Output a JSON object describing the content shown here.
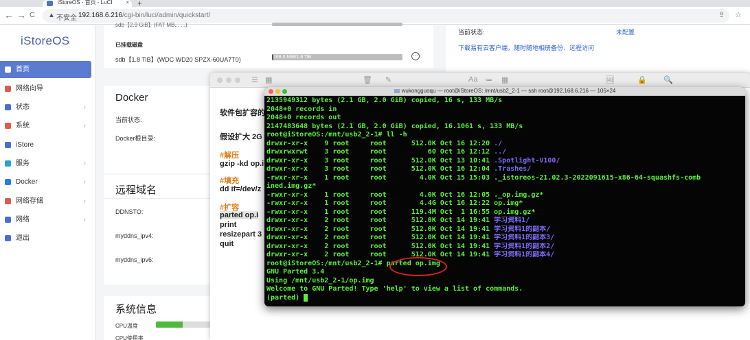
{
  "browser": {
    "tab_title": "iStoreOS - 首页 - LuCI",
    "tab_close": "×",
    "new_tab": "+",
    "back": "←",
    "forward": "→",
    "reload": "C",
    "home": "⌂",
    "warning_icon": "▲",
    "insecure_label": "不安全",
    "url_host": "192.168.6.216",
    "url_path": "/cgi-bin/luci/admin/quickstart/"
  },
  "sidebar": {
    "logo": "iStoreOS",
    "items": [
      {
        "label": "首页",
        "icon": "home-icon",
        "color": "#ffffff",
        "chevron": ""
      },
      {
        "label": "网络向导",
        "icon": "wizard-icon",
        "color": "#e05a4a",
        "chevron": ""
      },
      {
        "label": "状态",
        "icon": "status-icon",
        "color": "#4a6fd0",
        "chevron": "›"
      },
      {
        "label": "系统",
        "icon": "system-icon",
        "color": "#e05a4a",
        "chevron": "›"
      },
      {
        "label": "iStore",
        "icon": "store-icon",
        "color": "#4a6fd0",
        "chevron": ""
      },
      {
        "label": "服务",
        "icon": "services-icon",
        "color": "#2aa0d8",
        "chevron": "›"
      },
      {
        "label": "Docker",
        "icon": "docker-icon",
        "color": "#2a7fd8",
        "chevron": "›"
      },
      {
        "label": "网络存储",
        "icon": "storage-icon",
        "color": "#e05a4a",
        "chevron": "›"
      },
      {
        "label": "网络",
        "icon": "network-icon",
        "color": "#4a6fd0",
        "chevron": "›"
      },
      {
        "label": "退出",
        "icon": "logout-icon",
        "color": "#4a6fd0",
        "chevron": ""
      }
    ]
  },
  "disk": {
    "top_label": "sdb【2.9 GiB】(FAT MB... ...)",
    "mounted_title": "已挂载磁盘",
    "mounted_disk": "sdb【1.8 TiB】(WDC WD20 SPZX-60UA7T0)",
    "usage_text": "168.0 MiB/1.8 TiB",
    "usage_fraction": 0.01
  },
  "right_panel": {
    "status_label": "当前状态:",
    "status_value": "未配置",
    "download_link": "下载易有云客户端，随时随地相册备份、远程访问"
  },
  "docker": {
    "title": "Docker",
    "status_label": "当前状态:",
    "root_label": "Docker根目录:"
  },
  "ddns": {
    "title": "远程域名",
    "rows": [
      "DDNSTO:",
      "myddns_ipv4:",
      "myddns_ipv6:"
    ]
  },
  "sysinfo": {
    "title": "系统信息",
    "cpu_label": "CPU温度",
    "cpu_usage_label": "CPU使用率",
    "cpu_fraction": 0.3
  },
  "notes": {
    "line1": "软件包扩容的",
    "line2": "假设扩大 2G",
    "h_unzip": "#解压",
    "cmd_unzip": "gzip -kd op.i",
    "h_fill": "#填充",
    "cmd_fill": "dd if=/dev/z",
    "h_expand": "#扩容",
    "cmd1": "parted op.i",
    "cmd2": "print",
    "cmd3": "resizepart 3",
    "cmd4": "quit",
    "toolbar_icons": [
      "☰",
      "▦",
      "🗑",
      "✎",
      "Aa",
      "≔",
      "▦",
      "🖼",
      "🔒",
      "🔍"
    ]
  },
  "terminal": {
    "title": "wukongguoqu — root@iStoreOS: /mnt/usb2_2-1 — ssh root@192.168.6.216 — 105×24",
    "lines": [
      [
        {
          "t": "2135949312 bytes (2.1 GB, 2.0 GiB) copied, 16 s, 133 MB/s",
          "c": "g"
        }
      ],
      [
        {
          "t": "2048+0 records in",
          "c": "g"
        }
      ],
      [
        {
          "t": "2048+0 records out",
          "c": "g"
        }
      ],
      [
        {
          "t": "2147483648 bytes (2.1 GB, 2.0 GiB) copied, 16.1061 s, 133 MB/s",
          "c": "g"
        }
      ],
      [
        {
          "t": "root@iStoreOS:/mnt/usb2_2-1# ll -h",
          "c": "g"
        }
      ],
      [
        {
          "t": "drwxr-xr-x    9 root     root      512.0K Oct 16 12:20 ",
          "c": "g"
        },
        {
          "t": "./",
          "c": "p"
        }
      ],
      [
        {
          "t": "drwxrwxrwt    3 root     root          60 Oct 16 12:12 ",
          "c": "g"
        },
        {
          "t": "../",
          "c": "p"
        }
      ],
      [
        {
          "t": "drwxr-xr-x    3 root     root      512.0K Oct 13 10:41 ",
          "c": "g"
        },
        {
          "t": ".Spotlight-V100/",
          "c": "p"
        }
      ],
      [
        {
          "t": "drwxr-xr-x    3 root     root      512.0K Oct 16 12:04 ",
          "c": "g"
        },
        {
          "t": ".Trashes/",
          "c": "p"
        }
      ],
      [
        {
          "t": "-rwxr-xr-x    1 root     root        4.0K Oct 15 15:03 ._istoreos-21.02.3-2022091615-x86-64-squashfs-comb",
          "c": "g"
        }
      ],
      [
        {
          "t": "ined.img.gz*",
          "c": "g"
        }
      ],
      [
        {
          "t": "-rwxr-xr-x    1 root     root        4.0K Oct 16 12:05 ._op.img.gz*",
          "c": "g"
        }
      ],
      [
        {
          "t": "-rwxr-xr-x    1 root     root        4.4G Oct 16 12:22 op.img*",
          "c": "g"
        }
      ],
      [
        {
          "t": "-rwxr-xr-x    1 root     root      119.4M Oct  1 16:55 op.img.gz*",
          "c": "g"
        }
      ],
      [
        {
          "t": "drwxr-xr-x    2 root     root      512.0K Oct 14 19:41 ",
          "c": "g"
        },
        {
          "t": "学习资料1/",
          "c": "p"
        }
      ],
      [
        {
          "t": "drwxr-xr-x    2 root     root      512.0K Oct 14 19:41 ",
          "c": "g"
        },
        {
          "t": "学习资料1的副本/",
          "c": "p"
        }
      ],
      [
        {
          "t": "drwxr-xr-x    2 root     root      512.0K Oct 14 19:41 ",
          "c": "g"
        },
        {
          "t": "学习资料1的副本3/",
          "c": "p"
        }
      ],
      [
        {
          "t": "drwxr-xr-x    2 root     root      512.0K Oct 14 19:41 ",
          "c": "g"
        },
        {
          "t": "学习资料1的副本2/",
          "c": "p"
        }
      ],
      [
        {
          "t": "drwxr-xr-x    2 root     root      512.0K Oct 14 19:41 ",
          "c": "g"
        },
        {
          "t": "学习资料1的副本4/",
          "c": "p"
        }
      ],
      [
        {
          "t": "root@iStoreOS:/mnt/usb2_2-1# parted op.img",
          "c": "g"
        }
      ],
      [
        {
          "t": "GNU Parted 3.4",
          "c": "g"
        }
      ],
      [
        {
          "t": "Using /mnt/usb2_2-1/op.img",
          "c": "g"
        }
      ],
      [
        {
          "t": "Welcome to GNU Parted! Type 'help' to view a list of commands.",
          "c": "g"
        }
      ],
      [
        {
          "t": "(parted) ",
          "c": "g"
        }
      ]
    ]
  },
  "colors": {
    "accent": "#5b7bd1",
    "terminal_green": "#5af03a",
    "terminal_purple": "#7d6bf5",
    "annotation_red": "#e02020"
  }
}
